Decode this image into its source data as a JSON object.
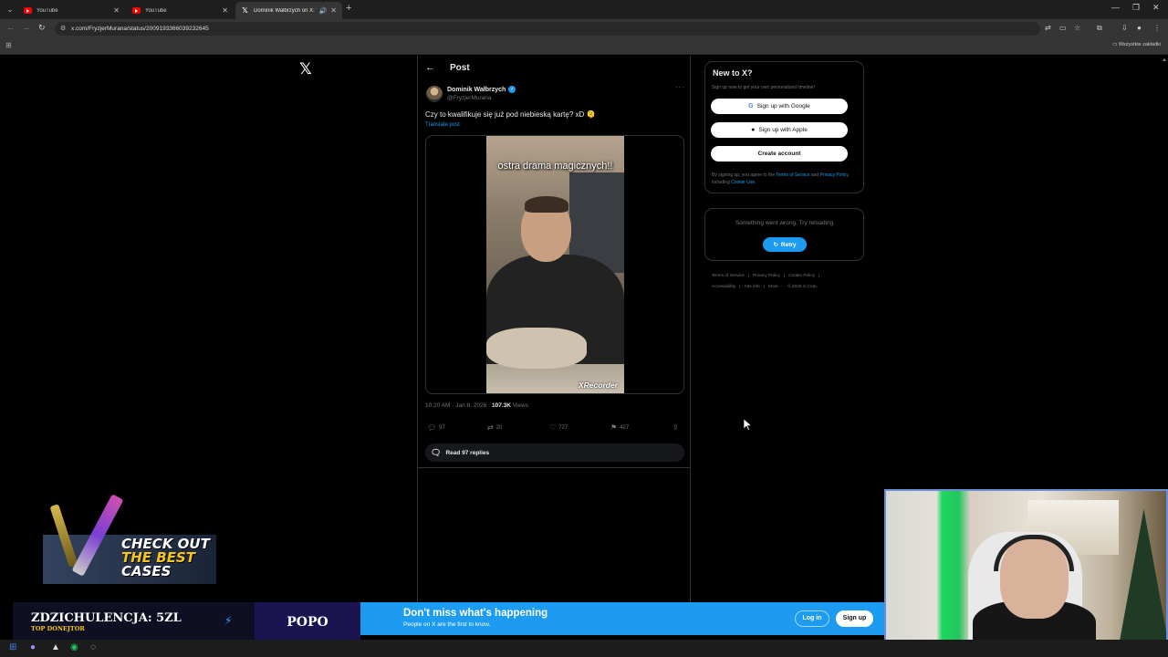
{
  "tabs": [
    {
      "title": "YouTube",
      "icon": "youtube"
    },
    {
      "title": "YouTube",
      "icon": "youtube"
    },
    {
      "title": "Dominik Wałbrzych on X: \"",
      "icon": "x",
      "active": true
    }
  ],
  "address": {
    "url": "x.com/FryzjerMurana/status/2009193366039232645"
  },
  "bookmarks": {
    "all_label": "Wszystkie zakładki"
  },
  "post": {
    "header_title": "Post",
    "author_name": "Dominik Wałbrzych",
    "author_handle": "@FryzjerMurana",
    "text": "Czy to kwalifikuje się już pod niebieską kartę? xD 🫠",
    "translate": "Translate post",
    "video_caption": "ostra drama magicznych!!",
    "video_watermark": "XRecorder",
    "timestamp": "10:20 AM · Jan 8, 2026 · ",
    "views_count": "107.3K",
    "views_label": " Views",
    "replies": "97",
    "reposts": "20",
    "likes": "727",
    "bookmarks": "427",
    "read_replies": "Read 97 replies"
  },
  "sidebar": {
    "new_title": "New to X?",
    "new_sub": "Sign up now to get your own personalized timeline!",
    "google_btn": "Sign up with Google",
    "apple_btn": "Sign up with Apple",
    "create_btn": "Create account",
    "legal_pre": "By signing up, you agree to the ",
    "legal_tos": "Terms of Service",
    "legal_and": " and ",
    "legal_privacy": "Privacy Policy",
    "legal_incl": ", including ",
    "legal_cookie": "Cookie Use.",
    "error_msg": "Something went wrong. Try reloading.",
    "retry": "Retry",
    "footer": [
      "Terms of Service",
      "|",
      "Privacy Policy",
      "|",
      "Cookie Policy",
      "|",
      "Accessibility",
      "|",
      "Ads info",
      "|",
      "More ···",
      "© 2026 X Corp."
    ]
  },
  "overlay": {
    "promo_line1": "CHECK OUT",
    "promo_line2": "THE BEST",
    "promo_line3": "CASES",
    "donor_name": "ZDZICHULENCJA: 5ZL",
    "donor_label": "TOP DONEJTOR",
    "donor_tag": "POPO"
  },
  "banner": {
    "headline": "Don't miss what's happening",
    "sub": "People on X are the first to know.",
    "login": "Log in",
    "signup": "Sign up"
  },
  "colors": {
    "accent": "#1d9bf0",
    "bg": "#000000",
    "border": "#2f3336",
    "muted": "#71767b"
  }
}
